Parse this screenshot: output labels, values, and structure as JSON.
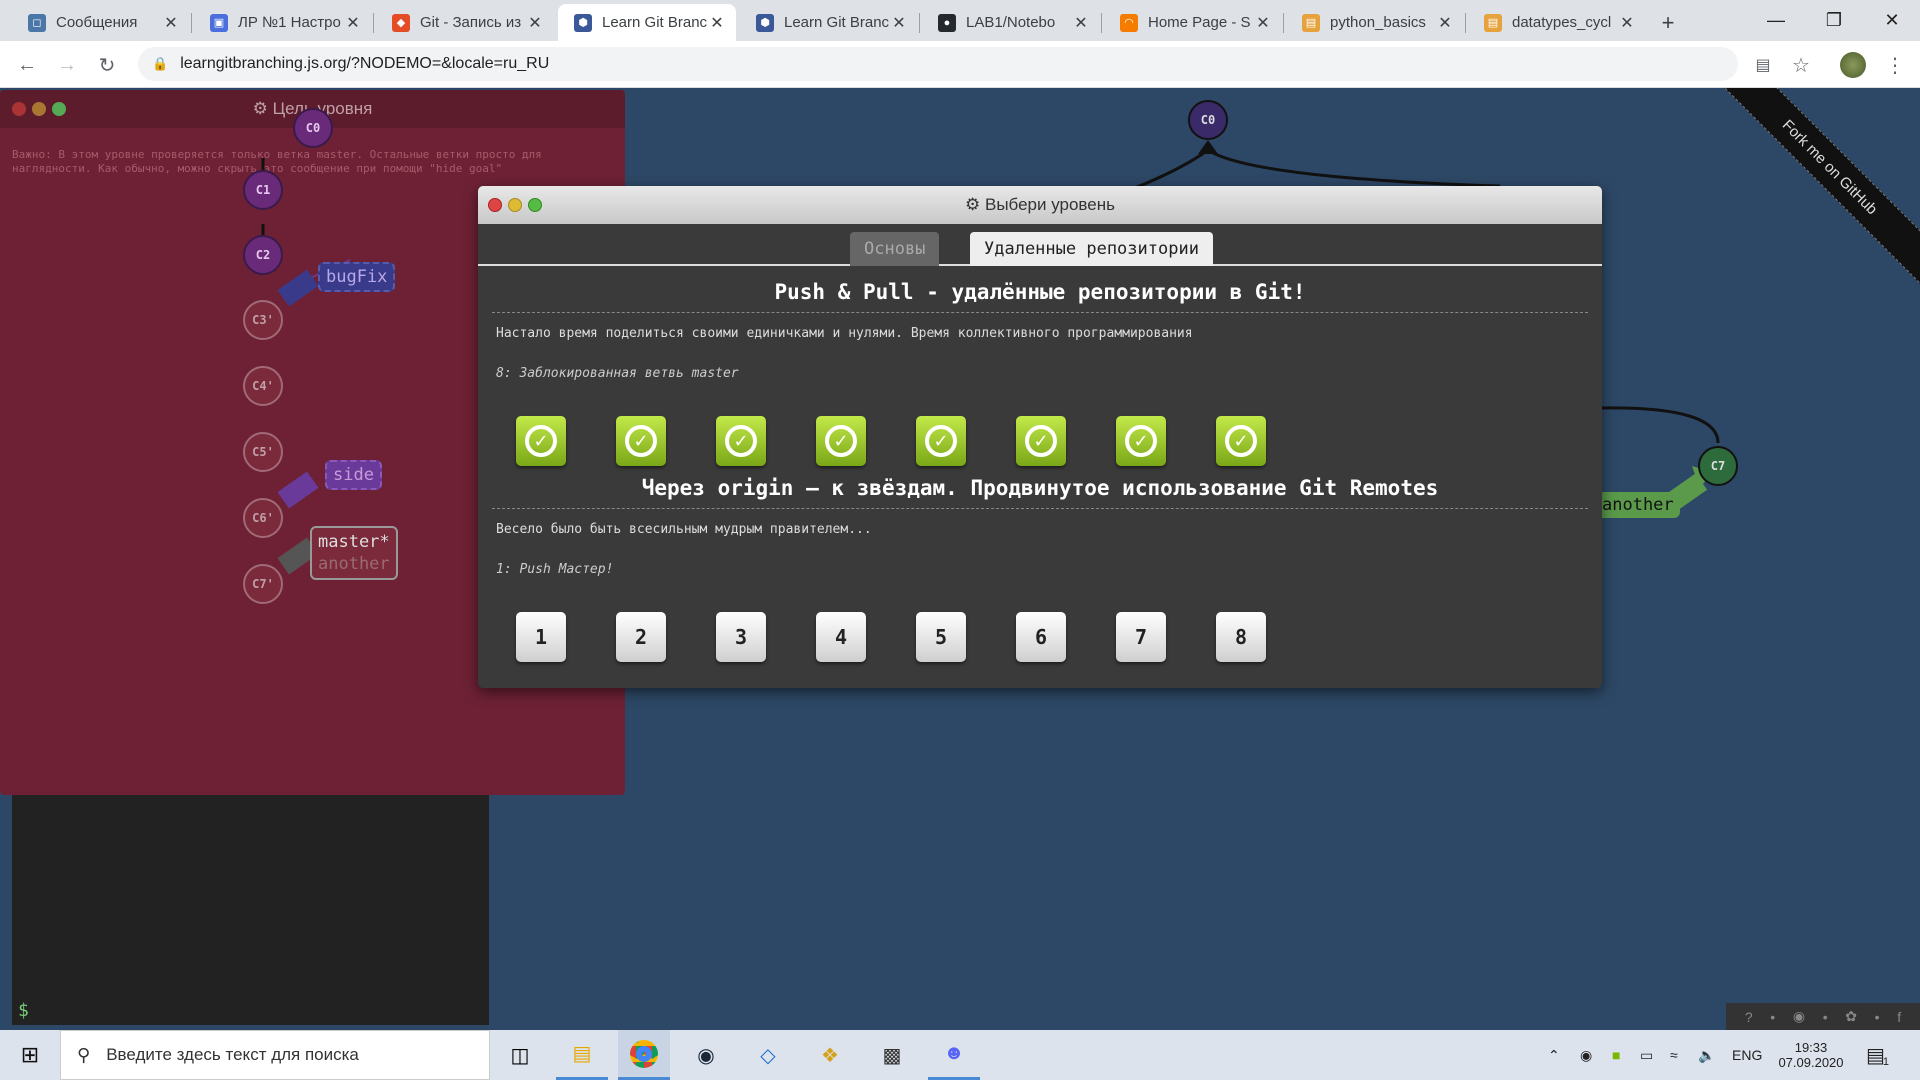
{
  "browser": {
    "tabs": [
      {
        "title": "Сообщения",
        "favicon_color": "#4a76a8",
        "favicon_glyph": "◻"
      },
      {
        "title": "ЛР №1 Настро",
        "favicon_color": "#4a6fdc",
        "favicon_glyph": "▣"
      },
      {
        "title": "Git - Запись из",
        "favicon_color": "#e44d26",
        "favicon_glyph": "◆"
      },
      {
        "title": "Learn Git Branc",
        "favicon_color": "#3b5998",
        "favicon_glyph": "⬢"
      },
      {
        "title": "Learn Git Branc",
        "favicon_color": "#3b5998",
        "favicon_glyph": "⬢"
      },
      {
        "title": "LAB1/Notebo",
        "favicon_color": "#24292e",
        "favicon_glyph": "●"
      },
      {
        "title": "Home Page - S",
        "favicon_color": "#f57c00",
        "favicon_glyph": "◠"
      },
      {
        "title": "python_basics",
        "favicon_color": "#e6a23c",
        "favicon_glyph": "▤"
      },
      {
        "title": "datatypes_cycl",
        "favicon_color": "#e6a23c",
        "favicon_glyph": "▤"
      }
    ],
    "active_tab_index": 3,
    "new_tab_label": "+",
    "url": "learngitbranching.js.org/?NODEMO=&locale=ru_RU"
  },
  "goal_window": {
    "title": "Цель уровня",
    "note": "Важно: В этом уровне проверяется только ветка master. Остальные ветки просто для наглядности. Как обычно, можно скрыть это сообщение при помощи \"hide goal\"",
    "commits": [
      "C0",
      "C1",
      "C2",
      "C3'",
      "C4'",
      "C5'",
      "C6'",
      "C7'"
    ],
    "branches": [
      "bugFix",
      "side",
      "master*",
      "another"
    ]
  },
  "background_tree": {
    "commits": [
      "C0",
      "C7"
    ],
    "branch": "another"
  },
  "fork_ribbon": "Fork me on GitHub",
  "terminal": {
    "prompt": "$"
  },
  "chooser": {
    "title": "Выбери уровень",
    "tabs": [
      {
        "label": "Основы",
        "active": false
      },
      {
        "label": "Удаленные репозитории",
        "active": true
      }
    ],
    "sections": [
      {
        "title": "Push & Pull - удалённые репозитории в Git!",
        "about": "Настало время поделиться своими единичками и нулями. Время коллективного программирования",
        "selected_level": "8: Заблокированная ветвь master",
        "levels": [
          "✓",
          "✓",
          "✓",
          "✓",
          "✓",
          "✓",
          "✓",
          "✓"
        ],
        "completed": true
      },
      {
        "title": "Через origin – к звёздам. Продвинутое использование Git Remotes",
        "about": "Весело было быть всесильным мудрым правителем...",
        "selected_level": "1: Push Мастер!",
        "levels": [
          "1",
          "2",
          "3",
          "4",
          "5",
          "6",
          "7",
          "8"
        ],
        "completed": false
      }
    ]
  },
  "social_icons": [
    "help-icon",
    "globe-icon",
    "twitter-icon",
    "facebook-icon"
  ],
  "taskbar": {
    "search_placeholder": "Введите здесь текст для поиска",
    "apps": [
      "task-view",
      "file-explorer",
      "chrome",
      "steam",
      "app-blue",
      "app-colorful",
      "terminal",
      "discord"
    ],
    "lang": "ENG",
    "time": "19:33",
    "date": "07.09.2020",
    "notif_count": "1"
  }
}
